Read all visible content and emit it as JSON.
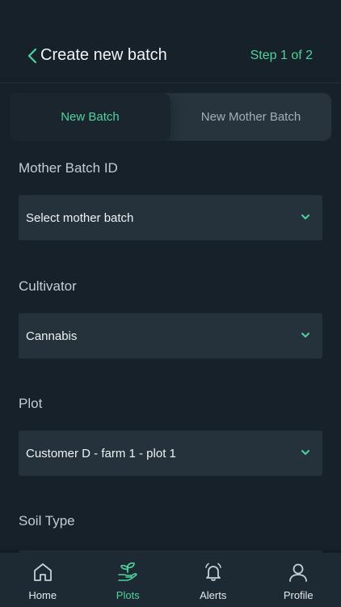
{
  "header": {
    "title": "Create new batch",
    "step": "Step 1 of 2",
    "back_icon": "chevron-left-icon"
  },
  "tabs": [
    {
      "label": "New Batch",
      "active": true
    },
    {
      "label": "New Mother Batch",
      "active": false
    }
  ],
  "form": {
    "mother_batch": {
      "label": "Mother Batch ID",
      "value": "Select mother batch"
    },
    "cultivator": {
      "label": "Cultivator",
      "value": "Cannabis"
    },
    "plot": {
      "label": "Plot",
      "value": "Customer D - farm 1 - plot 1"
    },
    "soil_type": {
      "label": "Soil Type"
    }
  },
  "nav": {
    "items": [
      {
        "label": "Home",
        "icon": "home-icon",
        "active": false
      },
      {
        "label": "Plots",
        "icon": "plant-hand-icon",
        "active": true
      },
      {
        "label": "Alerts",
        "icon": "bell-icon",
        "active": false
      },
      {
        "label": "Profile",
        "icon": "user-icon",
        "active": false
      }
    ]
  },
  "colors": {
    "background": "#17212a",
    "accent": "#4fd39b",
    "field": "#25323b"
  }
}
